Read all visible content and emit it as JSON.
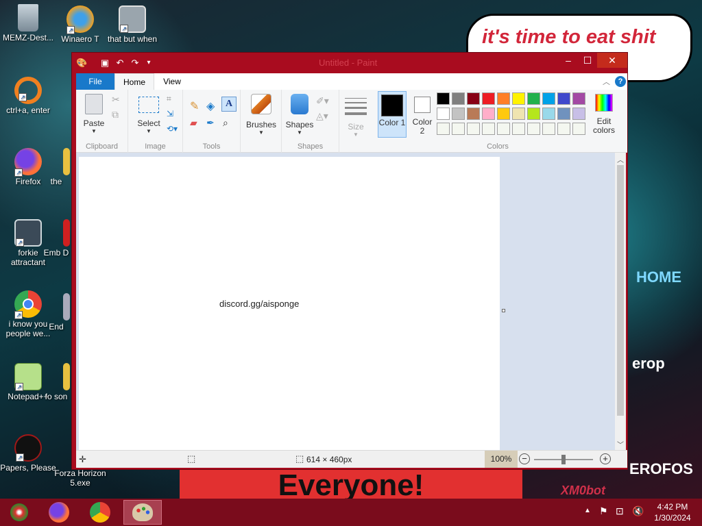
{
  "desktop": {
    "icons": [
      {
        "label": "MEMZ-Dest...",
        "icon": "recycle-bin-icon"
      },
      {
        "label": "Winaero T",
        "icon": "winaero-icon"
      },
      {
        "label": "that but when",
        "icon": "stacked-windows-icon"
      },
      {
        "label": "ctrl+a, enter",
        "icon": "fish-icon"
      },
      {
        "label": "Firefox",
        "icon": "firefox-icon"
      },
      {
        "label": "the",
        "icon": "file-icon"
      },
      {
        "label": "forkie attractant",
        "icon": "settings-monitor-icon"
      },
      {
        "label": "Emb D",
        "icon": "file-icon"
      },
      {
        "label": "i know you people we...",
        "icon": "chrome-icon"
      },
      {
        "label": "End",
        "icon": "file-icon"
      },
      {
        "label": "Notepad++",
        "icon": "notepad-plus-plus-icon"
      },
      {
        "label": "fo son",
        "icon": "file-icon"
      },
      {
        "label": "Papers, Please",
        "icon": "papers-please-icon"
      },
      {
        "label": "Forza Horizon 5.exe",
        "icon": "forza-icon"
      }
    ],
    "bubble_text": "it's time to eat shit ebrate",
    "banner_text": "Everyone!",
    "side_texts": [
      "HOME",
      "erop",
      "EROFOS",
      "XM0bot"
    ]
  },
  "paint": {
    "title": "Untitled - Paint",
    "tabs": [
      "File",
      "Home",
      "View"
    ],
    "groups": {
      "clipboard": {
        "label": "Clipboard",
        "paste": "Paste"
      },
      "image": {
        "label": "Image",
        "select": "Select"
      },
      "tools": {
        "label": "Tools"
      },
      "brushes": {
        "label": "Brushes"
      },
      "shapes": {
        "label": "Shapes",
        "button": "Shapes"
      },
      "size": {
        "label": "Size"
      },
      "colors": {
        "label": "Colors",
        "color1": "Color 1",
        "color2": "Color 2",
        "edit": "Edit colors"
      }
    },
    "palette_row1": [
      "#000000",
      "#7f7f7f",
      "#880015",
      "#ed1c24",
      "#ff7f27",
      "#fff200",
      "#22b14c",
      "#00a2e8",
      "#3f48cc",
      "#a349a4"
    ],
    "palette_row2": [
      "#ffffff",
      "#c3c3c3",
      "#b97a57",
      "#ffaec9",
      "#ffc90e",
      "#efe4b0",
      "#b5e61d",
      "#99d9ea",
      "#7092be",
      "#c8bfe7"
    ],
    "palette_row3": [
      "#f4f7f0",
      "#f4f7f0",
      "#f4f7f0",
      "#f4f7f0",
      "#f4f7f0",
      "#f4f7f0",
      "#f4f7f0",
      "#f4f7f0",
      "#f4f7f0",
      "#f4f7f0"
    ],
    "color1": "#000000",
    "color2": "#ffffff",
    "canvas_text": "discord.gg/aisponge",
    "status": {
      "canvas_size": "614 × 460px",
      "zoom": "100%"
    }
  },
  "taskbar": {
    "time": "4:42 PM",
    "date": "1/30/2024"
  }
}
